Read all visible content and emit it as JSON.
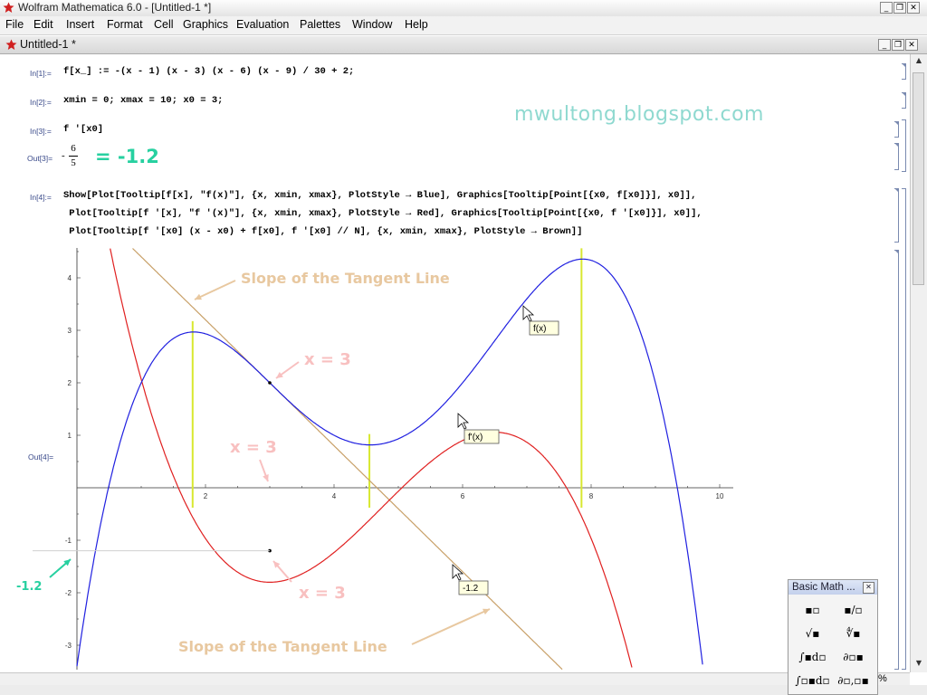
{
  "app": {
    "title": "Wolfram Mathematica 6.0 - [Untitled-1 *]",
    "menu": [
      "File",
      "Edit",
      "Insert",
      "Format",
      "Cell",
      "Graphics",
      "Evaluation",
      "Palettes",
      "Window",
      "Help"
    ]
  },
  "window_controls": {
    "minimize": "_",
    "restore": "❐",
    "close": "✕"
  },
  "document": {
    "title": "Untitled-1 *"
  },
  "watermark": "mwultong.blogspot.com",
  "cells": [
    {
      "label": "In[1]:=",
      "code": "f[x_] := -(x - 1) (x - 3) (x - 6) (x - 9) / 30 + 2;"
    },
    {
      "label": "In[2]:=",
      "code": "xmin = 0; xmax = 10; x0 = 3;"
    },
    {
      "label": "In[3]:=",
      "code": "f '[x0]"
    },
    {
      "label": "Out[3]=",
      "numerator": "6",
      "denominator": "5",
      "sign": "-",
      "annotation": "= -1.2"
    },
    {
      "label": "In[4]:=",
      "code": [
        "Show[Plot[Tooltip[f[x], \"f(x)\"], {x, xmin, xmax}, PlotStyle → Blue], Graphics[Tooltip[Point[{x0, f[x0]}], x0]],",
        " Plot[Tooltip[f '[x], \"f '(x)\"], {x, xmin, xmax}, PlotStyle → Red], Graphics[Tooltip[Point[{x0, f '[x0]}], x0]],",
        " Plot[Tooltip[f '[x0] (x - x0) + f[x0], f '[x0] // N], {x, xmin, xmax}, PlotStyle → Brown]]"
      ]
    },
    {
      "label": "Out[4]="
    }
  ],
  "chart_data": {
    "type": "line",
    "x_range": [
      0,
      10
    ],
    "y_range": [
      -3.3,
      4.6
    ],
    "x_ticks": [
      "2",
      "4",
      "6",
      "8",
      "10"
    ],
    "y_ticks": [
      "4",
      "3",
      "2",
      "1",
      "-1",
      "-2",
      "-3"
    ],
    "series": [
      {
        "name": "f(x)",
        "color": "#2020e0",
        "formula": "-(x-1)(x-3)(x-6)(x-9)/30+2"
      },
      {
        "name": "f'(x)",
        "color": "#e02020",
        "formula": "derivative of f"
      },
      {
        "name": "-1.2",
        "color": "#c8a068",
        "formula": "-1.2(x-3)+2"
      }
    ],
    "points": [
      {
        "x": 3,
        "y": 2
      },
      {
        "x": 3,
        "y": -1.2
      }
    ],
    "critical_x": [
      1.8,
      4.55,
      7.85
    ],
    "critical_line_color": "#d8e830",
    "tooltips": [
      "f(x)",
      "f'(x)",
      "-1.2"
    ],
    "annotations": {
      "slope_top": "Slope of the Tangent Line",
      "slope_bottom": "Slope of the Tangent Line",
      "x_eq_1": "x = 3",
      "x_eq_2": "x = 3",
      "x_eq_3": "x = 3",
      "minus_value": "-1.2"
    }
  },
  "palette": {
    "title": "Basic Math ...",
    "close": "✕",
    "buttons": [
      "▪▫",
      "▪/▫",
      "√▪",
      "∜▪",
      "∫▪d▫",
      "∂▫▪",
      "∫▫▪d▫",
      "∂▫,▫▪"
    ]
  },
  "status": {
    "zoom": "%"
  }
}
